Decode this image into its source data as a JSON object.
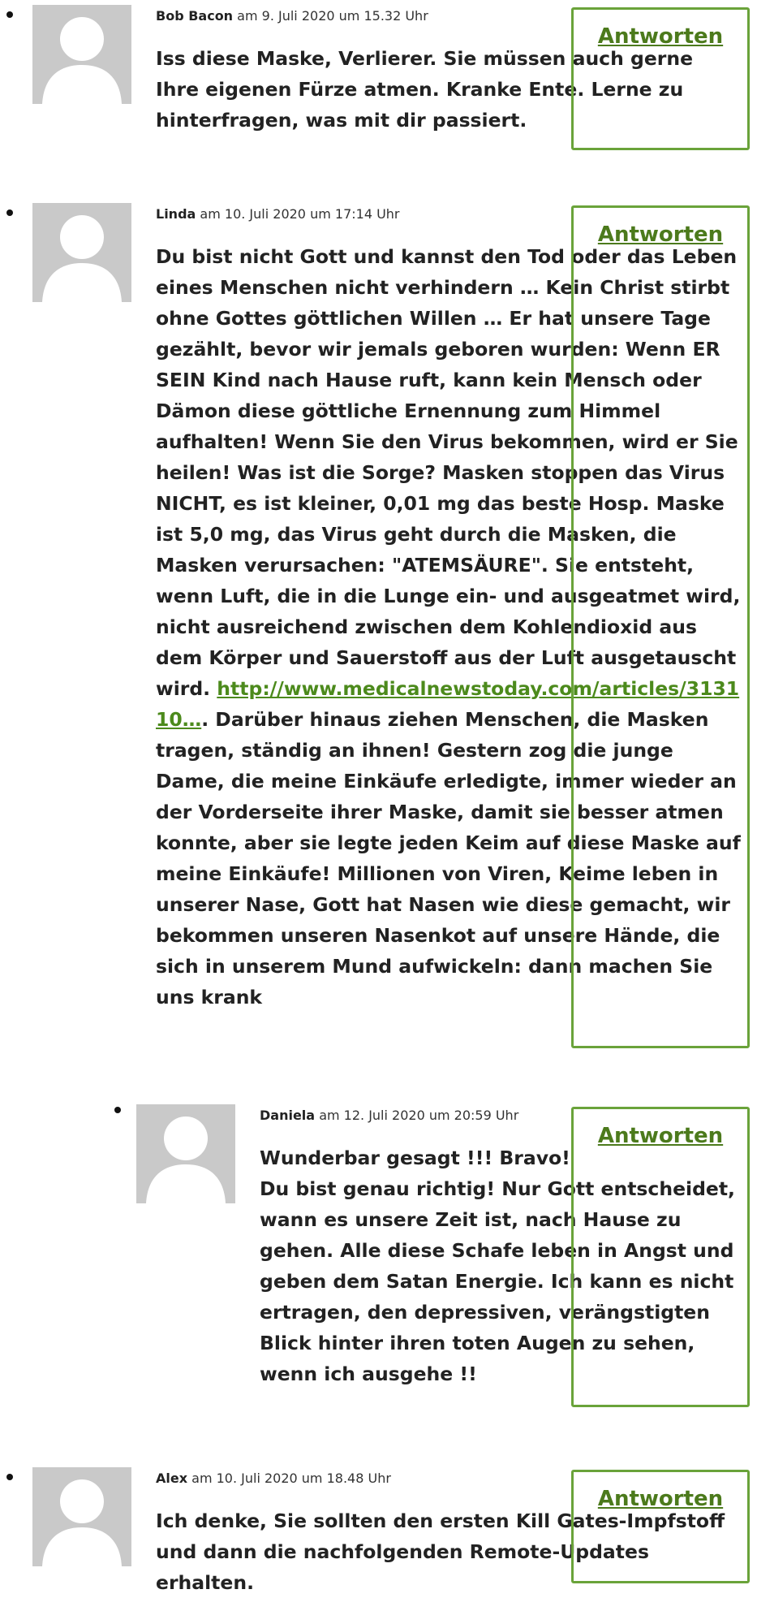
{
  "comments": [
    {
      "author": "Bob Bacon",
      "date": "am 9. Juli 2020 um 15.32 Uhr",
      "text": "Iss diese Maske, Verlierer. Sie müssen auch gerne Ihre eigenen Fürze atmen. Kranke Ente. Lerne zu hinterfragen, was mit dir passiert.",
      "reply_label": "Antworten"
    },
    {
      "author": "Linda",
      "date": "am 10. Juli 2020 um 17:14 Uhr",
      "text_before_link": "Du bist nicht Gott und kannst den Tod oder das Leben eines Menschen nicht verhindern … Kein Christ stirbt ohne Gottes göttlichen Willen … Er hat unsere Tage gezählt, bevor wir jemals geboren wurden: Wenn ER SEIN Kind nach Hause ruft, kann kein Mensch oder Dämon diese göttliche Ernennung zum Himmel aufhalten! Wenn Sie den Virus bekommen, wird er Sie heilen! Was ist die Sorge? Masken stoppen das Virus NICHT, es ist kleiner, 0,01 mg das beste Hosp. Maske ist 5,0 mg, das Virus geht durch die Masken, die Masken verursachen: \"ATEMSÄURE\". Sie entsteht, wenn Luft, die in die Lunge ein- und ausgeatmet wird, nicht ausreichend zwischen dem Kohlendioxid aus dem Körper und Sauerstoff aus der Luft ausgetauscht wird. ",
      "link": "http://www.medicalnewstoday.com/articles/313110…",
      "text_after_link": ". Darüber hinaus ziehen Menschen, die Masken tragen, ständig an ihnen! Gestern zog die junge Dame, die meine Einkäufe erledigte, immer wieder an der Vorderseite ihrer Maske, damit sie besser atmen konnte, aber sie legte jeden Keim auf diese Maske auf meine Einkäufe! Millionen von Viren, Keime leben in unserer Nase, Gott hat Nasen wie diese gemacht, wir bekommen unseren Nasenkot auf unsere Hände, die sich in unserem Mund aufwickeln: dann machen Sie uns krank",
      "reply_label": "Antworten"
    },
    {
      "author": "Daniela",
      "date": "am 12. Juli 2020 um 20:59 Uhr",
      "text_line1": "Wunderbar gesagt !!! Bravo!",
      "text_line2": "Du bist genau richtig! Nur Gott entscheidet, wann es unsere Zeit ist, nach Hause zu gehen. Alle diese Schafe leben in Angst und geben dem Satan Energie. Ich kann es nicht ertragen, den depressiven, verängstigten Blick hinter ihren toten Augen zu sehen, wenn ich ausgehe !!",
      "reply_label": "Antworten"
    },
    {
      "author": "Alex",
      "date": "am 10. Juli 2020 um 18.48 Uhr",
      "text": "Ich denke, Sie sollten den ersten Kill Gates-Impfstoff und dann die nachfolgenden Remote-Updates erhalten.",
      "reply_label": "Antworten"
    }
  ],
  "colors": {
    "reply_border": "#6aa33a",
    "reply_text": "#4c7a1c",
    "link": "#4c8a1c",
    "avatar_bg": "#c9c9c9"
  }
}
